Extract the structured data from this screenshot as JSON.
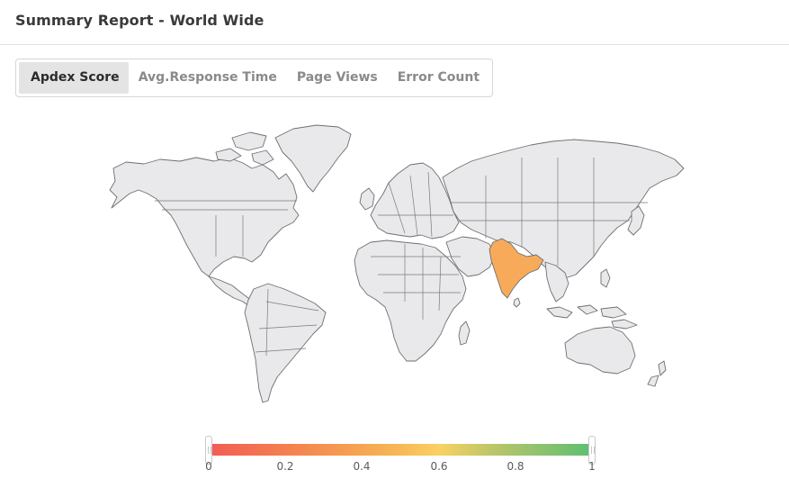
{
  "header": {
    "title": "Summary Report - World Wide"
  },
  "tabs": [
    {
      "label": "Apdex Score",
      "active": true
    },
    {
      "label": "Avg.Response Time",
      "active": false
    },
    {
      "label": "Page Views",
      "active": false
    },
    {
      "label": "Error Count",
      "active": false
    }
  ],
  "map": {
    "highlighted_region": "India",
    "highlight_color": "#f7ab5a",
    "land_color": "#e9e9ec",
    "border_color": "#6f6f6f"
  },
  "legend": {
    "min": 0,
    "max": 1,
    "ticks": [
      "0",
      "0.2",
      "0.4",
      "0.6",
      "0.8",
      "1"
    ],
    "colors": [
      "#f25c54",
      "#f7b955",
      "#5cbf72"
    ]
  }
}
